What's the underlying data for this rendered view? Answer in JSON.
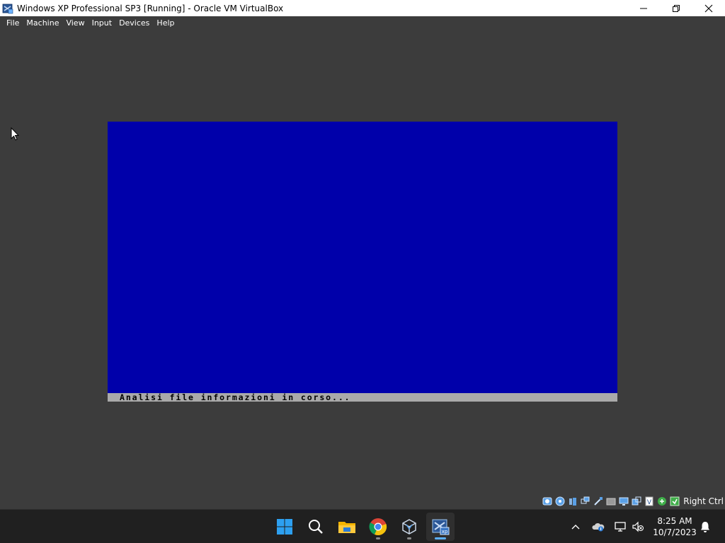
{
  "window": {
    "title": "Windows XP Professional SP3 [Running] - Oracle VM VirtualBox",
    "icon": "virtualbox-xp-icon",
    "controls": [
      "minimize-icon",
      "maximize-icon",
      "close-icon"
    ]
  },
  "menubar": {
    "items": [
      {
        "label": "File"
      },
      {
        "label": "Machine"
      },
      {
        "label": "View"
      },
      {
        "label": "Input"
      },
      {
        "label": "Devices"
      },
      {
        "label": "Help"
      }
    ]
  },
  "vm_screen": {
    "background": "#0000aa",
    "status_bar_color": "#aaaaaa",
    "status_text": "Analisi file informazioni in corso..."
  },
  "vm_statusbar": {
    "icons": [
      "hard-disk-icon",
      "optical-drive-icon",
      "audio-icon",
      "network-icon",
      "usb-icon",
      "shared-folders-icon",
      "display-icon",
      "video-capture-icon",
      "virtualization-icon",
      "mouse-integration-icon",
      "keyboard-icon"
    ],
    "host_key": "Right Ctrl"
  },
  "taskbar": {
    "apps": [
      {
        "name": "start-icon"
      },
      {
        "name": "search-icon"
      },
      {
        "name": "file-explorer-icon"
      },
      {
        "name": "chrome-icon"
      },
      {
        "name": "virtualbox-icon"
      },
      {
        "name": "virtualbox-xp-vm-icon"
      }
    ],
    "tray_icons": [
      "chevron-up-icon",
      "onedrive-icon",
      "network-icon",
      "volume-muted-icon"
    ],
    "clock": {
      "time": "8:25 AM",
      "date": "10/7/2023"
    },
    "notification_icon": "bell-icon"
  }
}
